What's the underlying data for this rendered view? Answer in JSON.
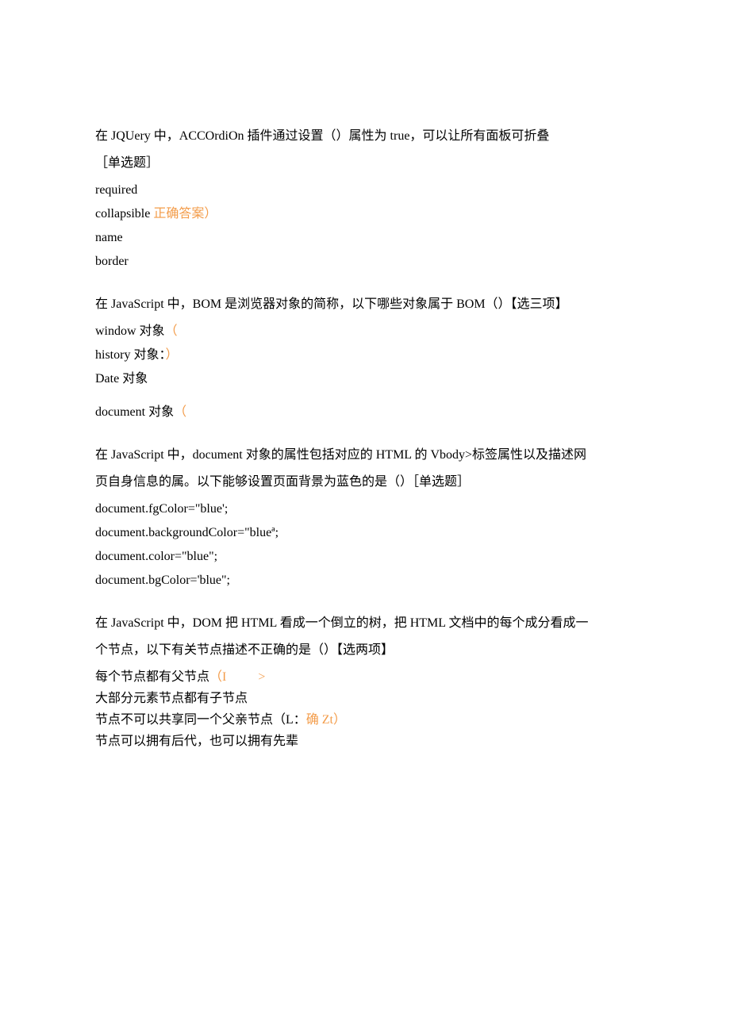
{
  "q1": {
    "stem1": "在 JQUery 中，ACCOrdiOn 插件通过设置（）属性为 true，可以让所有面板可折叠",
    "stem2": "［单选题］",
    "optA": "required",
    "optB_text": "collapsible ",
    "optB_ans": "正确答案）",
    "optC": "name",
    "optD": "border"
  },
  "q2": {
    "stem": "在 JavaScript 中，BOM 是浏览器对象的简称，以下哪些对象属于 BOM（）【选三项】",
    "optA_text": "window 对象",
    "optA_mark": "（",
    "optB_text": "history 对象：",
    "optB_mark": "）",
    "optC": "Date 对象",
    "optD_text": "document 对象",
    "optD_mark": "（"
  },
  "q3": {
    "stem1": "在 JavaScript 中，document 对象的属性包括对应的 HTML 的 Vbody>标签属性以及描述网",
    "stem2": "页自身信息的属。以下能够设置页面背景为蓝色的是（）［单选题］",
    "optA": "document.fgColor=\"blue';",
    "optB": "document.backgroundColor=\"blueª;",
    "optC": "document.color=\"blue\";",
    "optD": "document.bgColor='blue\";"
  },
  "q4": {
    "stem1": "在 JavaScript 中，DOM 把 HTML 看成一个倒立的树，把 HTML 文档中的每个成分看成一",
    "stem2": "个节点，以下有关节点描述不正确的是（）【选两项】",
    "optA_text": "每个节点都有父节点",
    "optA_mark1": "（I",
    "optA_mark2": ">",
    "optB": "大部分元素节点都有子节点",
    "optC_text": "节点不可以共享同一个父亲节点（L：",
    "optC_mark": "确 Zt）",
    "optD": "节点可以拥有后代，也可以拥有先辈"
  }
}
